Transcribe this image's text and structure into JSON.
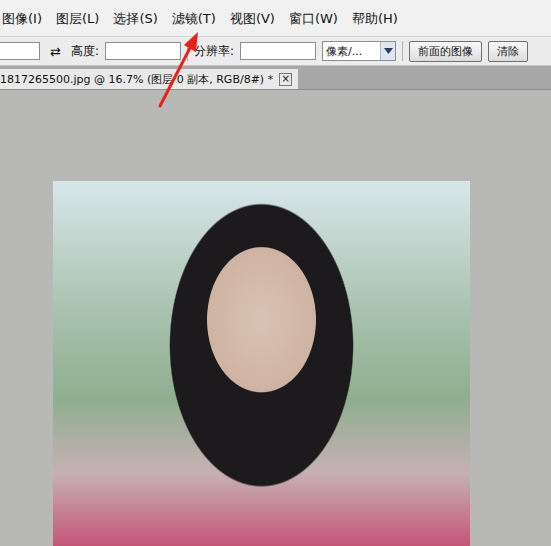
{
  "menu": [
    {
      "label": "图像(I)",
      "annotated": false
    },
    {
      "label": "图层(L)",
      "annotated": false
    },
    {
      "label": "选择(S)",
      "annotated": false
    },
    {
      "label": "滤镜(T)",
      "annotated": true
    },
    {
      "label": "视图(V)",
      "annotated": false
    },
    {
      "label": "窗口(W)",
      "annotated": false
    },
    {
      "label": "帮助(H)",
      "annotated": false
    }
  ],
  "options_bar": {
    "width_field": "",
    "swap_icon": "⇄",
    "height_label": "高度:",
    "height_field": "",
    "resolution_label": "分辨率:",
    "resolution_field": "",
    "unit_select": "像素/...",
    "buttons": [
      "前面的图像",
      "清除"
    ]
  },
  "document_tab": {
    "title": "1817265500.jpg @ 16.7% (图层 0 副本, RGB/8#) *",
    "close": "×"
  }
}
